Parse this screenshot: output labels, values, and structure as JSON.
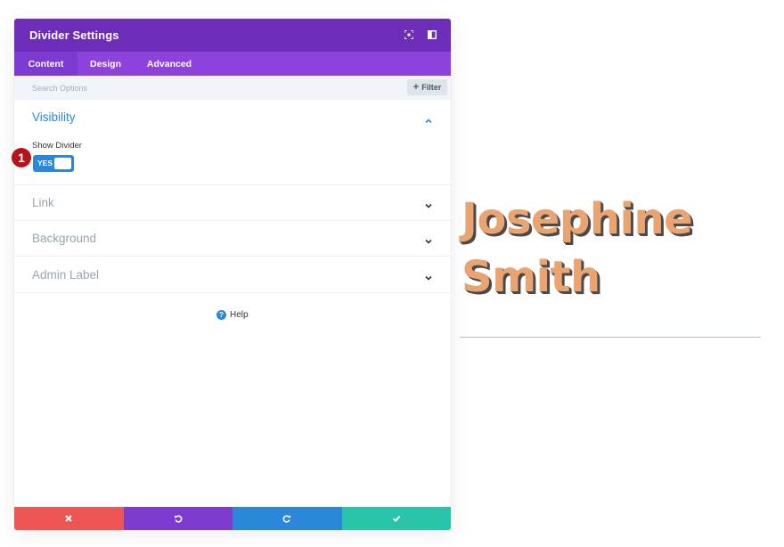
{
  "modal": {
    "title": "Divider Settings",
    "tabs": [
      {
        "label": "Content",
        "active": true
      },
      {
        "label": "Design",
        "active": false
      },
      {
        "label": "Advanced",
        "active": false
      }
    ],
    "search": {
      "placeholder": "Search Options"
    },
    "filter_label": "Filter",
    "sections": [
      {
        "title": "Visibility",
        "open": true
      },
      {
        "title": "Link",
        "open": false
      },
      {
        "title": "Background",
        "open": false
      },
      {
        "title": "Admin Label",
        "open": false
      }
    ],
    "visibility": {
      "option_label": "Show Divider",
      "toggle_value": "YES"
    },
    "step_badge": "1",
    "help_label": "Help",
    "footer_colors": [
      "#ef5555",
      "#7e3bd0",
      "#2b87da",
      "#29c4a9"
    ]
  },
  "preview": {
    "name_line1": "Josephine",
    "name_line2": "Smith",
    "name_color": "#eaa472",
    "divider_color": "#a9c1d6"
  },
  "colors": {
    "header": "#6c2eb9",
    "tabs": "#8e42dc",
    "accent": "#2b87da"
  }
}
